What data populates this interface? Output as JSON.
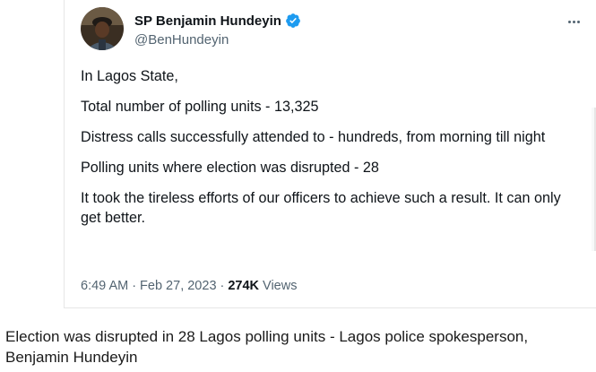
{
  "tweet": {
    "author_name": "SP Benjamin Hundeyin",
    "handle": "@BenHundeyin",
    "paragraphs": [
      "In Lagos State,",
      "Total number of polling units - 13,325",
      "Distress calls successfully attended to - hundreds, from morning till night",
      "Polling units where election was disrupted - 28",
      "It took the tireless efforts of our officers to achieve such a result. It can only get better."
    ],
    "time": "6:49 AM",
    "separator": "·",
    "date": "Feb 27, 2023",
    "views_count": "274K",
    "views_label": "Views"
  },
  "caption": "Election was disrupted in 28 Lagos polling units - Lagos police spokesperson, Benjamin Hundeyin",
  "colors": {
    "verified_badge": "#1d9bf0",
    "secondary_text": "#536471",
    "primary_text": "#0f1419"
  },
  "icons": {
    "verified": "verified-badge-icon",
    "more": "more-options-icon"
  }
}
